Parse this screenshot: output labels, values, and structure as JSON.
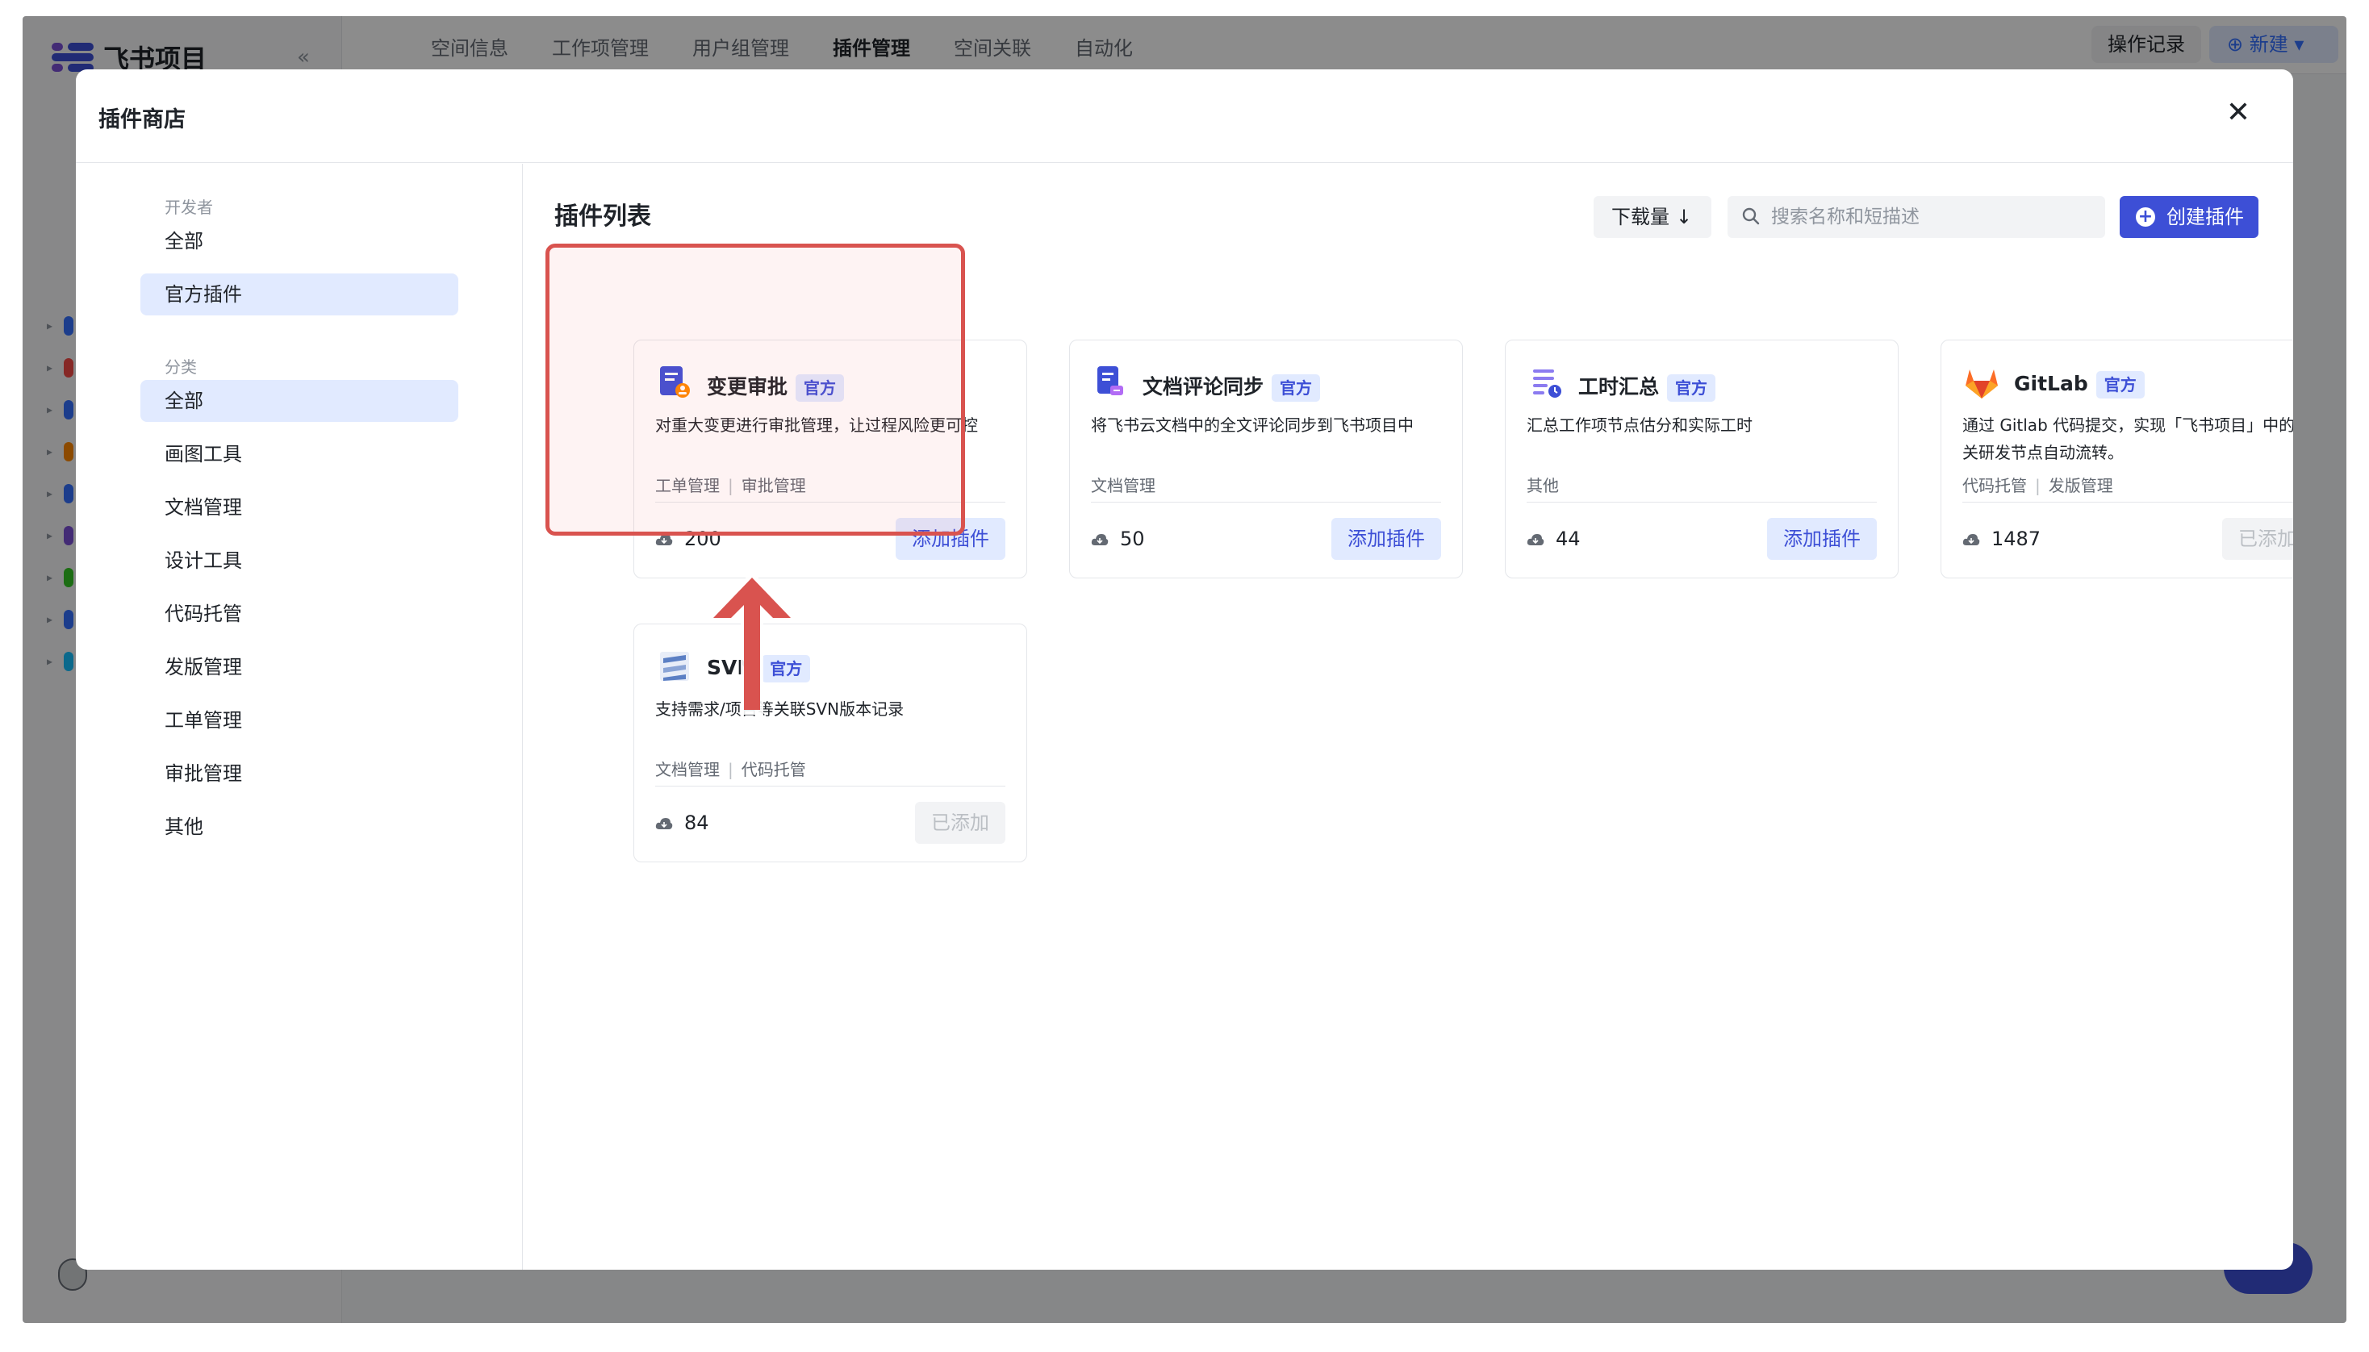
{
  "app": {
    "title": "飞书项目",
    "collapse_label": "«",
    "tabs": [
      "空间信息",
      "工作项管理",
      "用户组管理",
      "插件管理",
      "空间关联",
      "自动化"
    ],
    "active_tab": "插件管理",
    "op_record_label": "操作记录",
    "new_label": "新建"
  },
  "modal": {
    "title": "插件商店",
    "close_label": "✕"
  },
  "filters": {
    "developer_label": "开发者",
    "developer_items": [
      "全部",
      "官方插件"
    ],
    "category_label": "分类",
    "category_items": [
      "全部",
      "画图工具",
      "文档管理",
      "设计工具",
      "代码托管",
      "发版管理",
      "工单管理",
      "审批管理",
      "其他"
    ]
  },
  "toolbar": {
    "list_title": "插件列表",
    "sort_label": "下载量",
    "search_placeholder": "搜索名称和短描述",
    "create_label": "创建插件"
  },
  "plugins": [
    {
      "name": "变更审批",
      "badge": "官方",
      "desc": "对重大变更进行审批管理，让过程风险更可控",
      "tags": [
        "工单管理",
        "审批管理"
      ],
      "downloads": "200",
      "action": "添加插件"
    },
    {
      "name": "文档评论同步",
      "badge": "官方",
      "desc": "将飞书云文档中的全文评论同步到飞书项目中",
      "tags": [
        "文档管理"
      ],
      "downloads": "50",
      "action": "添加插件"
    },
    {
      "name": "工时汇总",
      "badge": "官方",
      "desc": "汇总工作项节点估分和实际工时",
      "tags": [
        "其他"
      ],
      "downloads": "44",
      "action": "添加插件"
    },
    {
      "name": "GitLab",
      "badge": "官方",
      "desc": "通过 Gitlab 代码提交，实现「飞书项目」中的相关研发节点自动流转。",
      "tags": [
        "代码托管",
        "发版管理"
      ],
      "downloads": "1487",
      "action": "已添加"
    },
    {
      "name": "SVN",
      "badge": "官方",
      "desc": "支持需求/项目等关联SVN版本记录",
      "tags": [
        "文档管理",
        "代码托管"
      ],
      "downloads": "84",
      "action": "已添加"
    }
  ],
  "colors": {
    "brand": "#3d4fd6",
    "highlight": "#d9534f"
  }
}
